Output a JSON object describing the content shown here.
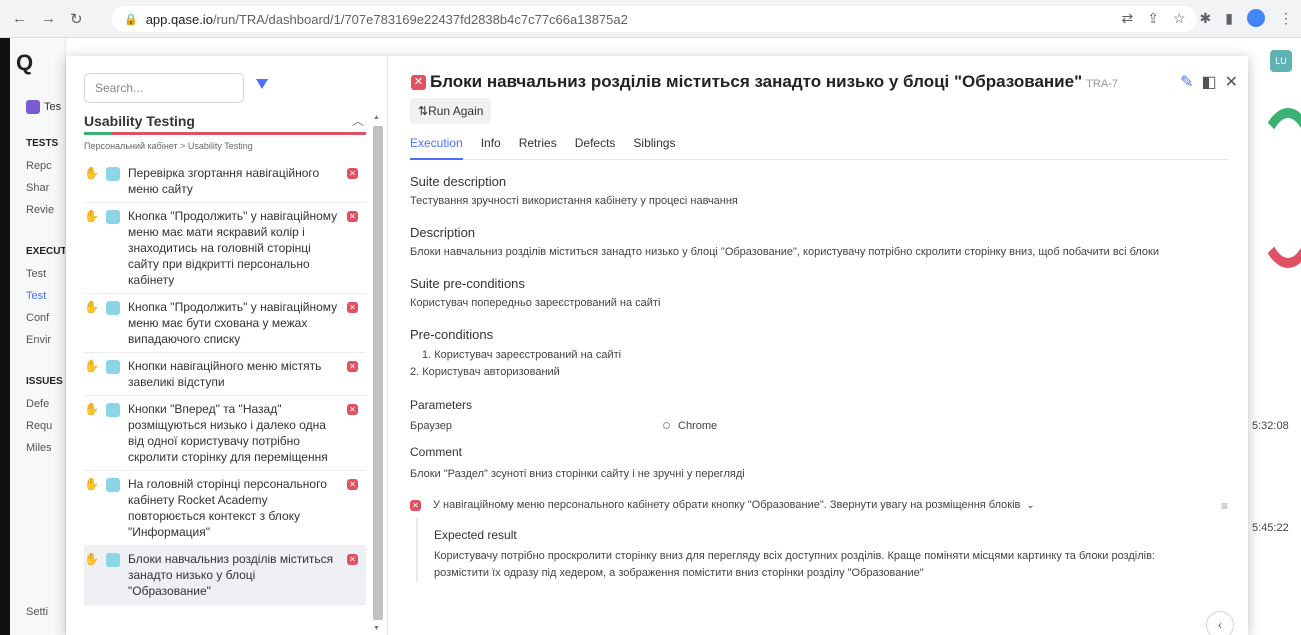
{
  "browser": {
    "url_host": "app.qase.io",
    "url_path": "/run/TRA/dashboard/1/707e783169e22437fd2838b4c7c77c66a13875a2"
  },
  "app": {
    "logo": "Q",
    "project_name": "Tes",
    "sidebar": {
      "tests_head": "TESTS",
      "tests_items": [
        "Repc",
        "Shar",
        "Revie"
      ],
      "execution_head": "EXECUTI",
      "execution_items": [
        "Test",
        "Test",
        "Conf",
        "Envir"
      ],
      "issues_head": "ISSUES",
      "issues_items": [
        "Defe",
        "Requ",
        "Miles"
      ],
      "settings": "Setti"
    },
    "avatar": "LU",
    "times": [
      "5:32:08",
      "5:45:22"
    ]
  },
  "modal": {
    "search_placeholder": "Search...",
    "suite_title": "Usability Testing",
    "breadcrumb": "Персональний кабінет > Usability Testing",
    "pass_fraction": 0.1,
    "cases": [
      "Перевірка згортання навігаційного меню сайту",
      "Кнопка \"Продолжить\" у навігаційному меню має мати яскравий колір і знаходитись на головній сторінці сайту при відкритті персонально кабінету",
      "Кнопка \"Продолжить\" у навігаційному меню має бути схована у межах випадаючого списку",
      "Кнопки навігаційного меню містять завеликі відступи",
      "Кнопки \"Вперед\" та \"Назад\" розміщуються низько і далеко одна від одної користувачу потрібно скролити сторінку для переміщення",
      "На головній сторінці персонального кабінету Rocket Academy повторюється контекст з блоку \"Информация\"",
      "Блоки навчальниз розділів міститься занадто низько у блоці \"Образование\""
    ],
    "detail": {
      "title": "Блоки навчальниз розділів міститься занадто низько у блоці \"Образование\"",
      "code": "TRA-7",
      "run_again": "Run Again",
      "tabs": [
        "Execution",
        "Info",
        "Retries",
        "Defects",
        "Siblings"
      ],
      "suite_description_h": "Suite description",
      "suite_description": "Тестування зручності використання кабінету у процесі навчання",
      "description_h": "Description",
      "description": "Блоки навчальниз розділів міститься занадто низько у блоці \"Образование\", користувачу потрібно скролити сторінку вниз, щоб побачити всі блоки",
      "suite_pre_h": "Suite pre-conditions",
      "suite_pre": "Користувач попередньо зареєстрований на сайті",
      "pre_h": "Pre-conditions",
      "pre_1": "1. Користувач зареєстрований на сайті",
      "pre_2": "2. Користувач авторизований",
      "parameters_h": "Parameters",
      "param_name": "Браузер",
      "param_value": "Chrome",
      "comment_h": "Comment",
      "comment": "Блоки \"Раздел\" зсуноті вниз сторінки сайту і не зручні у перегляді",
      "step": "У навігаційному меню персонального кабінету обрати кнопку \"Образование\". Звернути увагу на розміщення блоків",
      "expected_h": "Expected result",
      "expected_1": "Користувачу потрібно проскролити сторінку вниз для перегляду всіх доступних розділів. Краще поміняти місцями картинку та блоки розділів:",
      "expected_2": "розмістити їх одразу під хедером, а зображення помістити вниз сторінки розділу \"Образование\""
    }
  },
  "colors": {
    "accent": "#4c6fff",
    "fail": "#e05263",
    "pass": "#3bb273",
    "manual": "#8ad5e6"
  },
  "icons": [
    "back-icon",
    "forward-icon",
    "reload-icon",
    "lock-icon",
    "translate-icon",
    "share-icon",
    "star-icon",
    "extensions-icon",
    "sidebar-icon",
    "menu-icon",
    "filter-icon",
    "chevron-up-icon",
    "hand-icon",
    "manual-case-icon",
    "fail-icon",
    "edit-icon",
    "split-view-icon",
    "close-icon",
    "repeat-icon",
    "chevron-down-icon",
    "lines-icon",
    "chevron-left-icon"
  ]
}
